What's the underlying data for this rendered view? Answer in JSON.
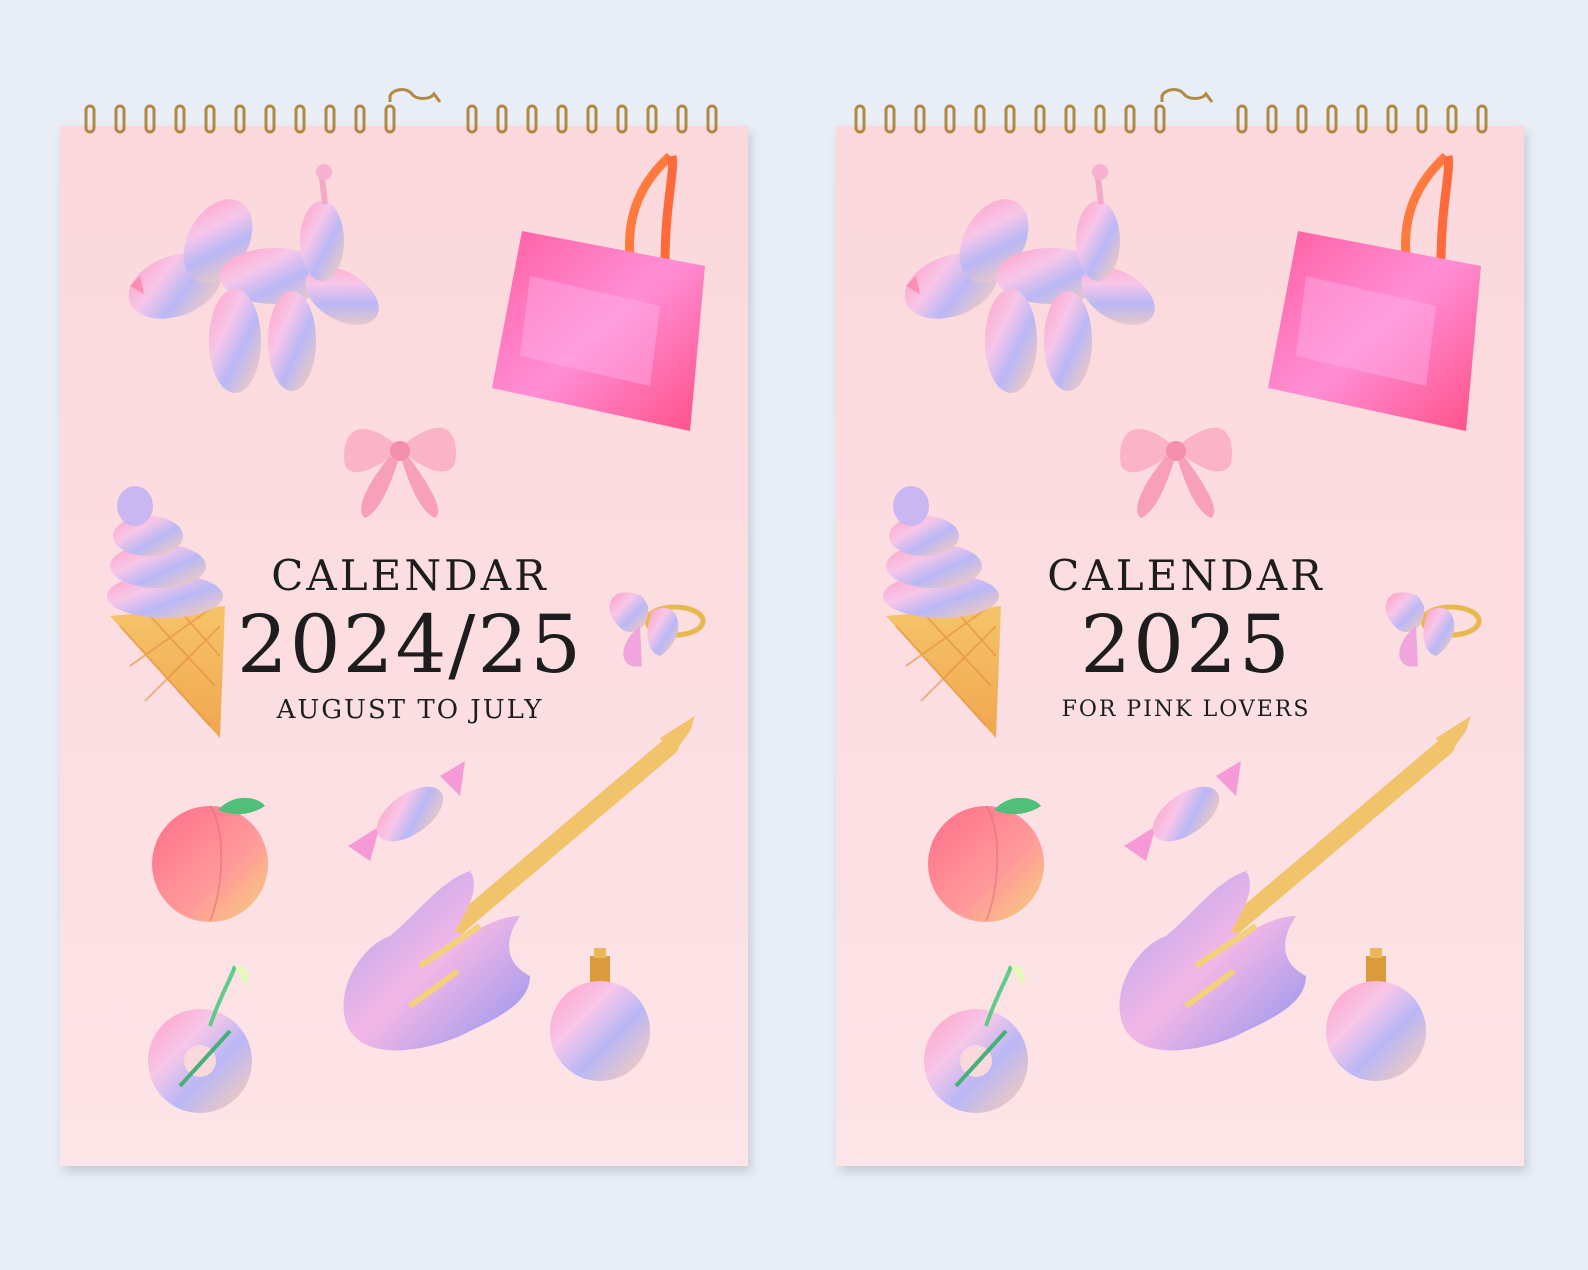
{
  "calendars": [
    {
      "label": "CALENDAR",
      "year": "2024/25",
      "subtitle": "AUGUST TO JULY"
    },
    {
      "label": "CALENDAR",
      "year": "2025",
      "subtitle": "FOR PINK LOVERS"
    }
  ],
  "colors": {
    "background": "#e9eef6",
    "page": "#fbd8dc",
    "binding_wire": "#b08a45",
    "text": "#1d1d1d"
  },
  "illustrations": [
    "balloon-dog",
    "tote-bag",
    "bow",
    "ice-cream-cone",
    "butterfly-ring",
    "wrapped-candy",
    "peach",
    "electric-guitar",
    "perfume-bottle",
    "donut-vase"
  ]
}
